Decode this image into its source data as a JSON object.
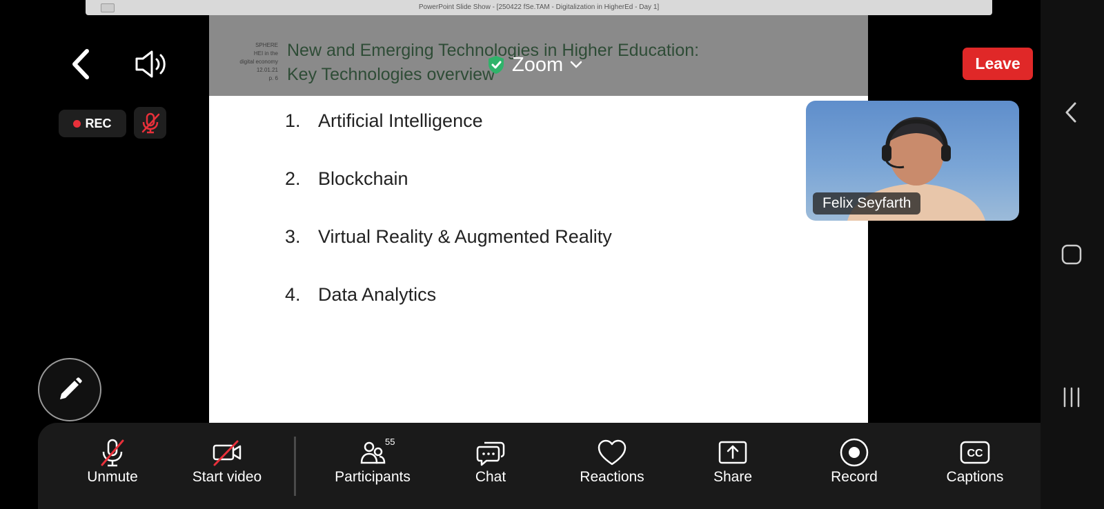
{
  "shared_window": {
    "title": "PowerPoint Slide Show - [250422 fSe.TAM - Digitalization in HigherEd - Day 1]"
  },
  "slide": {
    "meta": [
      "SPHERE",
      "HEI in the",
      "digital economy",
      "12.01.21",
      "p. 6"
    ],
    "title_line1": "New and Emerging Technologies in Higher Education:",
    "title_line2": "Key Technologies overview",
    "items": [
      {
        "num": "1.",
        "text": "Artificial Intelligence"
      },
      {
        "num": "2.",
        "text": "Blockchain"
      },
      {
        "num": "3.",
        "text": "Virtual Reality & Augmented Reality"
      },
      {
        "num": "4.",
        "text": "Data Analytics"
      }
    ]
  },
  "top_bar": {
    "app_name": "Zoom",
    "leave_label": "Leave",
    "rec_label": "REC"
  },
  "video": {
    "participant_name": "Felix Seyfarth"
  },
  "toolbar": {
    "unmute": "Unmute",
    "start_video": "Start video",
    "participants": "Participants",
    "participants_count": "55",
    "chat": "Chat",
    "reactions": "Reactions",
    "share": "Share",
    "record": "Record",
    "captions": "Captions"
  },
  "icons": {
    "shield_color": "#2fb36a",
    "leave_color": "#e02828",
    "mute_slash_color": "#e8303a"
  }
}
